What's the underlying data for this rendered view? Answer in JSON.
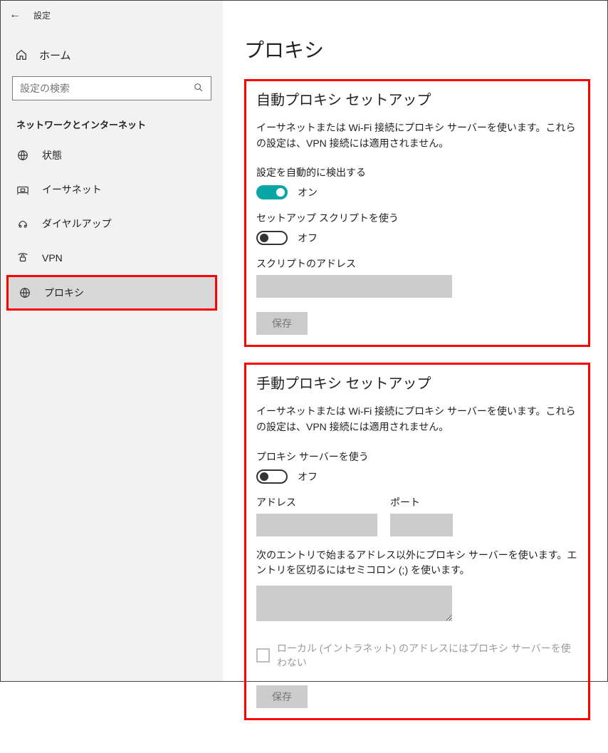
{
  "topbar": {
    "title": "設定"
  },
  "sidebar": {
    "home": "ホーム",
    "search_placeholder": "設定の検索",
    "category": "ネットワークとインターネット",
    "nav": {
      "status": "状態",
      "ethernet": "イーサネット",
      "dialup": "ダイヤルアップ",
      "vpn": "VPN",
      "proxy": "プロキシ"
    }
  },
  "page": {
    "title": "プロキシ"
  },
  "auto": {
    "title": "自動プロキシ セットアップ",
    "desc": "イーサネットまたは Wi-Fi 接続にプロキシ サーバーを使います。これらの設定は、VPN 接続には適用されません。",
    "detect_label": "設定を自動的に検出する",
    "detect_state": "オン",
    "script_label": "セットアップ スクリプトを使う",
    "script_state": "オフ",
    "script_addr_label": "スクリプトのアドレス",
    "script_addr_value": "",
    "save": "保存"
  },
  "manual": {
    "title": "手動プロキシ セットアップ",
    "desc": "イーサネットまたは Wi-Fi 接続にプロキシ サーバーを使います。これらの設定は、VPN 接続には適用されません。",
    "use_label": "プロキシ サーバーを使う",
    "use_state": "オフ",
    "address_label": "アドレス",
    "address_value": "",
    "port_label": "ポート",
    "port_value": "",
    "exceptions_label": "次のエントリで始まるアドレス以外にプロキシ サーバーを使います。エントリを区切るにはセミコロン (;) を使います。",
    "exceptions_value": "",
    "local_checkbox": "ローカル (イントラネット) のアドレスにはプロキシ サーバーを使わない",
    "save": "保存"
  }
}
